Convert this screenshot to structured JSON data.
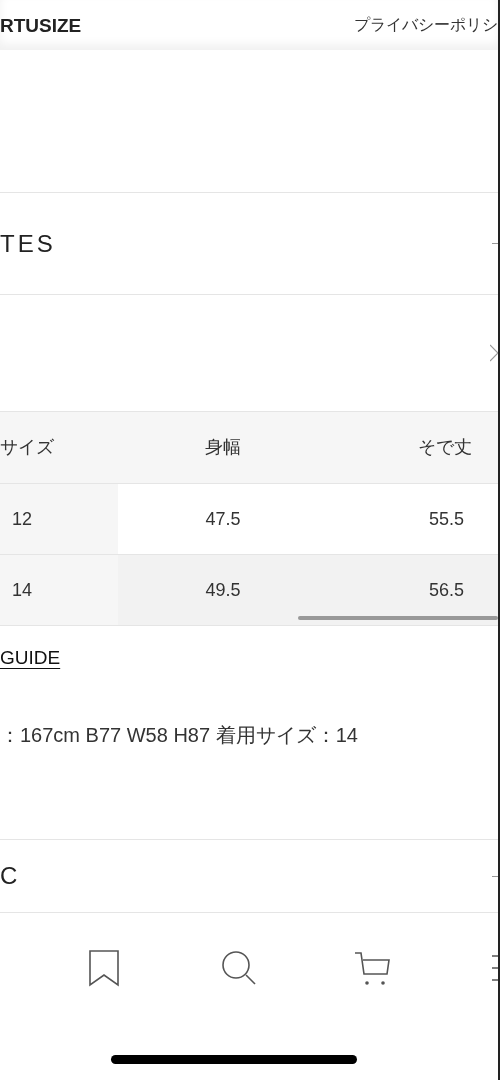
{
  "header": {
    "logo": "RTUSIZE",
    "link": "プライバシーポリシ"
  },
  "sections_top": [
    {
      "title": "TES",
      "kind": "minus"
    },
    {
      "kind": "chevron"
    }
  ],
  "table": {
    "columns": [
      "サイズ",
      "身幅",
      "そで丈"
    ],
    "rows": [
      {
        "cells": [
          "12",
          "47.5",
          "55.5"
        ],
        "selected": false
      },
      {
        "cells": [
          "14",
          "49.5",
          "56.5"
        ],
        "selected": true
      }
    ]
  },
  "guide_link": "GUIDE",
  "model_info": "：167cm B77 W58 H87 着用サイズ：14",
  "sections_bottom": [
    {
      "title": "C",
      "kind": "minus"
    }
  ],
  "nav": [
    {
      "kind": "bookmark"
    },
    {
      "kind": "search"
    },
    {
      "kind": "cart"
    },
    {
      "kind": "menu"
    }
  ]
}
